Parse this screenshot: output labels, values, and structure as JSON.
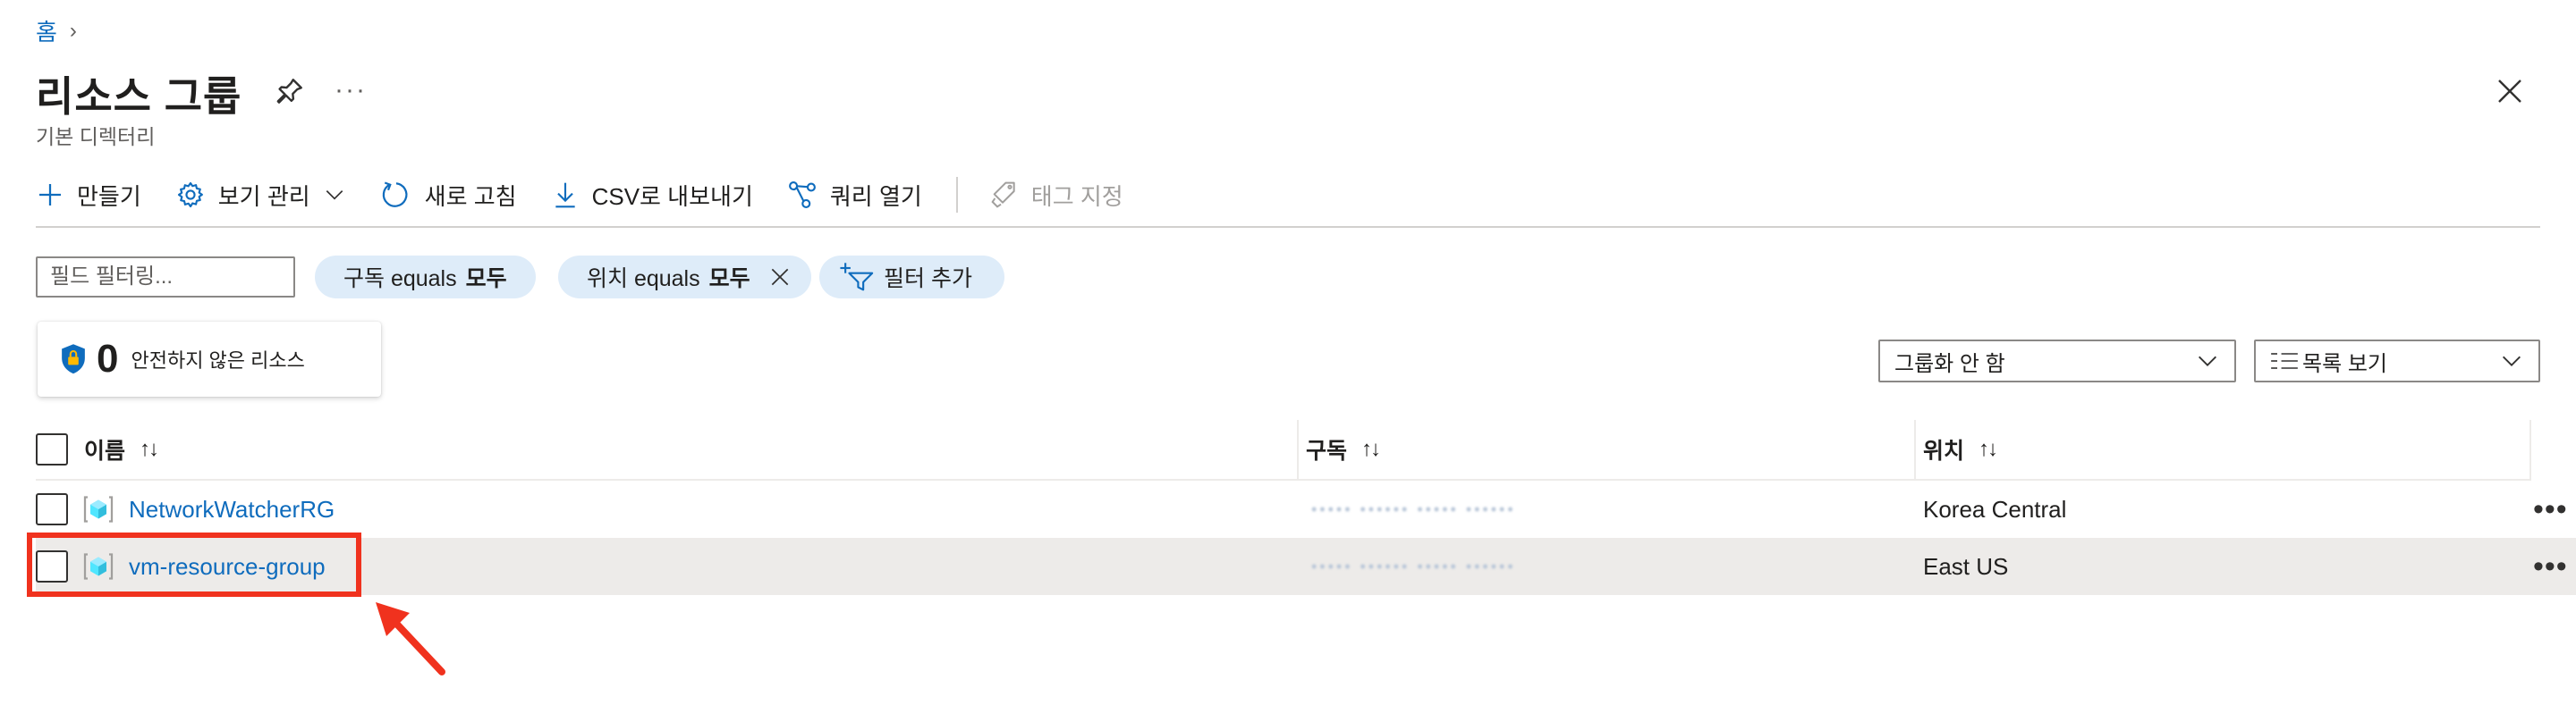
{
  "breadcrumb": {
    "home": "홈",
    "separator": "›"
  },
  "header": {
    "title": "리소스 그룹",
    "subtitle": "기본 디렉터리",
    "more": "···"
  },
  "toolbar": {
    "create": "만들기",
    "manage_view": "보기 관리",
    "refresh": "새로 고침",
    "export_csv": "CSV로 내보내기",
    "open_query": "쿼리 열기",
    "assign_tags": "태그 지정"
  },
  "filters": {
    "input_placeholder": "필드 필터링...",
    "subscription": {
      "prefix": "구독 equals",
      "value": "모두"
    },
    "location": {
      "prefix": "위치 equals",
      "value": "모두"
    },
    "add_filter": "필터 추가"
  },
  "summary": {
    "count": "0",
    "label": "안전하지 않은 리소스"
  },
  "grouping": {
    "selected": "그룹화 안 함"
  },
  "view_mode": {
    "selected": "목록 보기"
  },
  "table": {
    "columns": [
      {
        "label": "이름",
        "sort": "↑↓"
      },
      {
        "label": "구독",
        "sort": "↑↓"
      },
      {
        "label": "위치",
        "sort": "↑↓"
      }
    ],
    "rows": [
      {
        "name": "NetworkWatcherRG",
        "subscription": "•••••  ••••••  •••••  ••••••",
        "location": "Korea Central",
        "more": "•••"
      },
      {
        "name": "vm-resource-group",
        "subscription": "•••••  ••••••  •••••  ••••••",
        "location": "East US",
        "more": "•••"
      }
    ]
  },
  "colors": {
    "accent": "#0f6cbd",
    "pill_bg": "#deecf9",
    "selected_row": "#edebe9",
    "annotation_red": "#f0321e"
  }
}
